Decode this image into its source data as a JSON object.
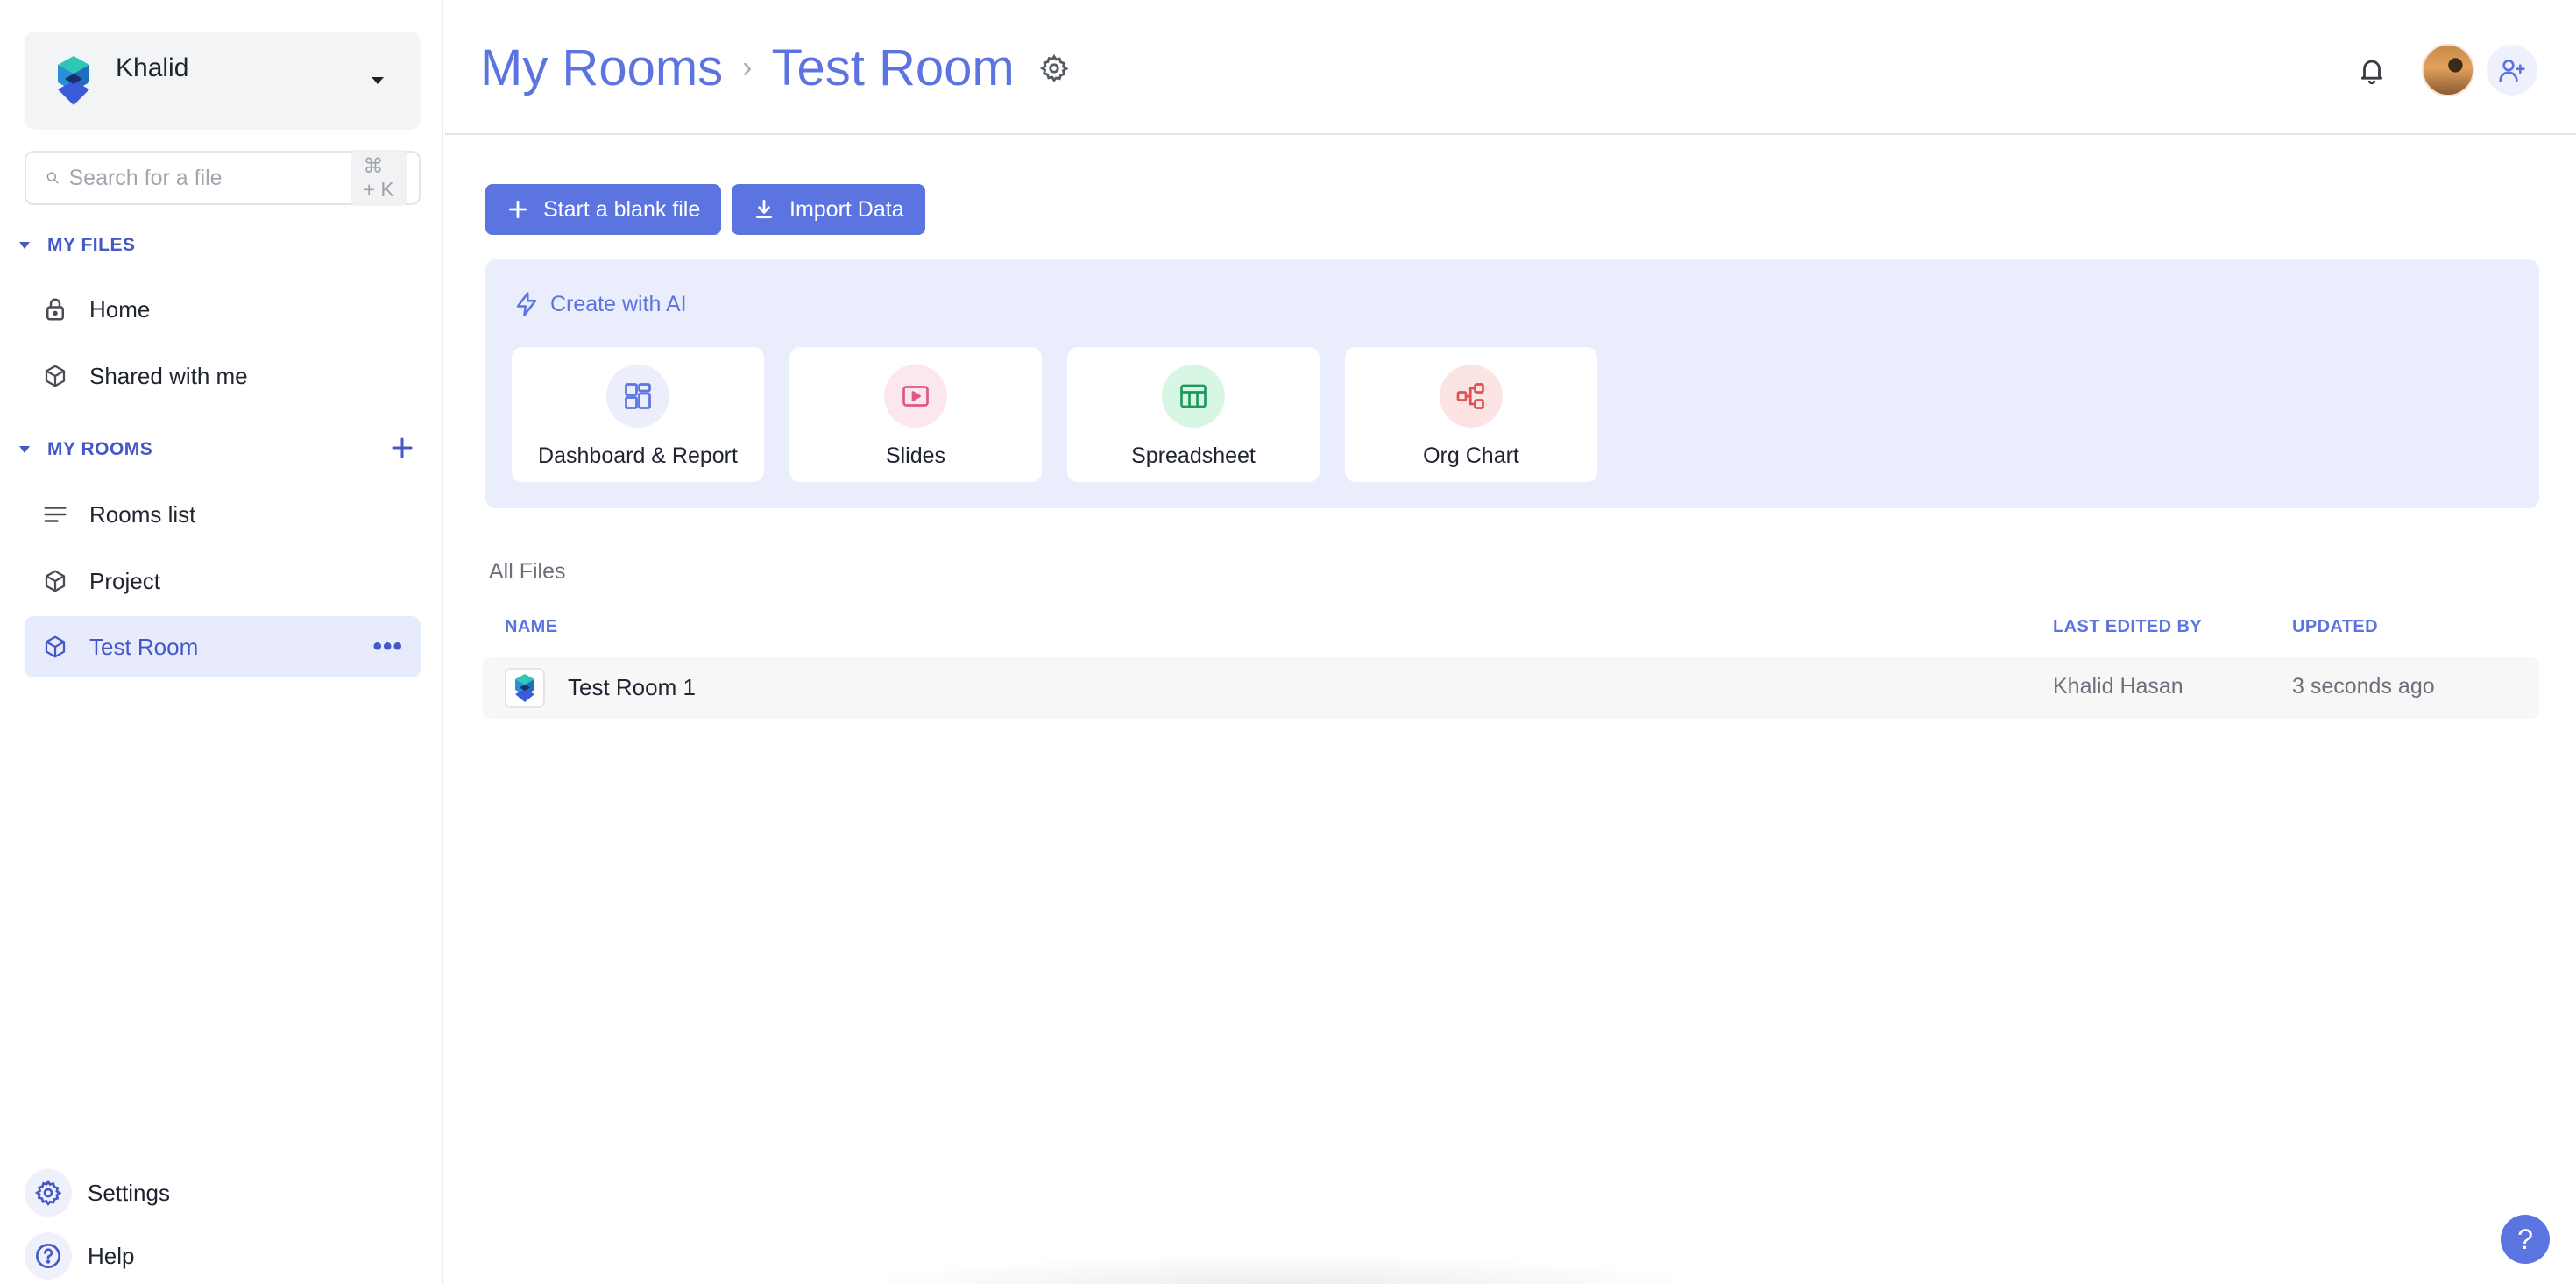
{
  "workspace": {
    "name": "Khalid"
  },
  "search": {
    "placeholder": "Search for a file",
    "shortcut": "⌘ + K"
  },
  "sidebar": {
    "my_files_heading": "MY FILES",
    "my_files": [
      {
        "label": "Home",
        "icon": "lock-icon"
      },
      {
        "label": "Shared with me",
        "icon": "cube-icon"
      }
    ],
    "my_rooms_heading": "MY ROOMS",
    "my_rooms": [
      {
        "label": "Rooms list",
        "icon": "list-icon"
      },
      {
        "label": "Project",
        "icon": "cube-icon"
      },
      {
        "label": "Test Room",
        "icon": "cube-icon",
        "active": true,
        "more": "•••"
      }
    ],
    "settings_label": "Settings",
    "help_label": "Help"
  },
  "header": {
    "breadcrumb_root": "My Rooms",
    "breadcrumb_sep": "›",
    "breadcrumb_current": "Test Room"
  },
  "toolbar": {
    "blank_file_label": "Start a blank file",
    "import_label": "Import Data"
  },
  "ai": {
    "title": "Create with AI",
    "cards": [
      {
        "label": "Dashboard & Report",
        "icon": "dashboard-icon",
        "color": "#5b74e0",
        "bg": "#eceefb"
      },
      {
        "label": "Slides",
        "icon": "slides-icon",
        "color": "#e0568a",
        "bg": "#fde7ef"
      },
      {
        "label": "Spreadsheet",
        "icon": "spreadsheet-icon",
        "color": "#1f9a5c",
        "bg": "#d7f6e4"
      },
      {
        "label": "Org Chart",
        "icon": "org-chart-icon",
        "color": "#e05252",
        "bg": "#fde4e4"
      }
    ]
  },
  "files": {
    "section_label": "All Files",
    "columns": {
      "name": "NAME",
      "last_edited_by": "LAST EDITED BY",
      "updated": "UPDATED"
    },
    "rows": [
      {
        "name": "Test Room 1",
        "last_edited_by": "Khalid Hasan",
        "updated": "3 seconds ago"
      }
    ]
  },
  "help_fab": "?",
  "colors": {
    "accent": "#5b74e0",
    "accent_dark": "#4458c7",
    "panel": "#eaedfc"
  }
}
